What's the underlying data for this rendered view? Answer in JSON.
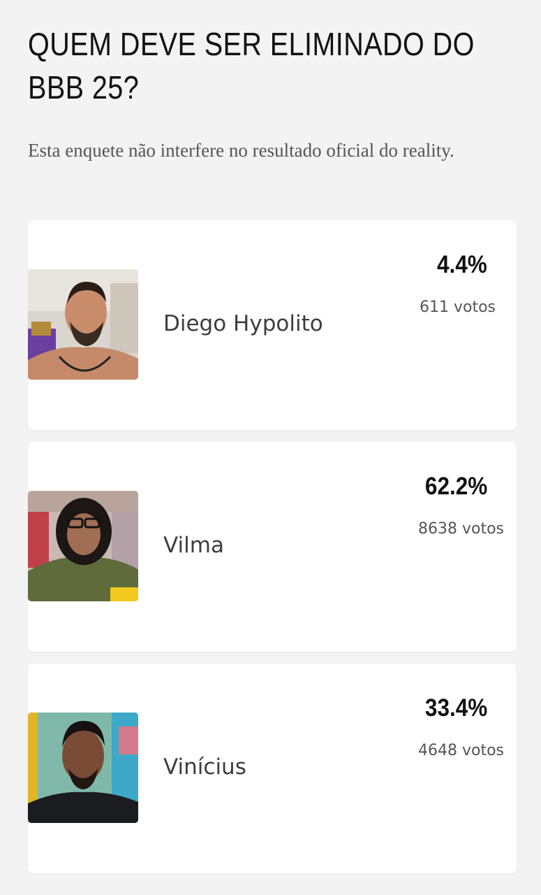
{
  "poll": {
    "title": "QUEM DEVE SER ELIMINADO DO BBB 25?",
    "subtitle": "Esta enquete não interfere no resultado oficial do reality.",
    "options": [
      {
        "name": "Diego Hypolito",
        "percent": "4.4%",
        "votes": "611 votos"
      },
      {
        "name": "Vilma",
        "percent": "62.2%",
        "votes": "8638 votos"
      },
      {
        "name": "Vinícius",
        "percent": "33.4%",
        "votes": "4648 votos"
      }
    ]
  }
}
